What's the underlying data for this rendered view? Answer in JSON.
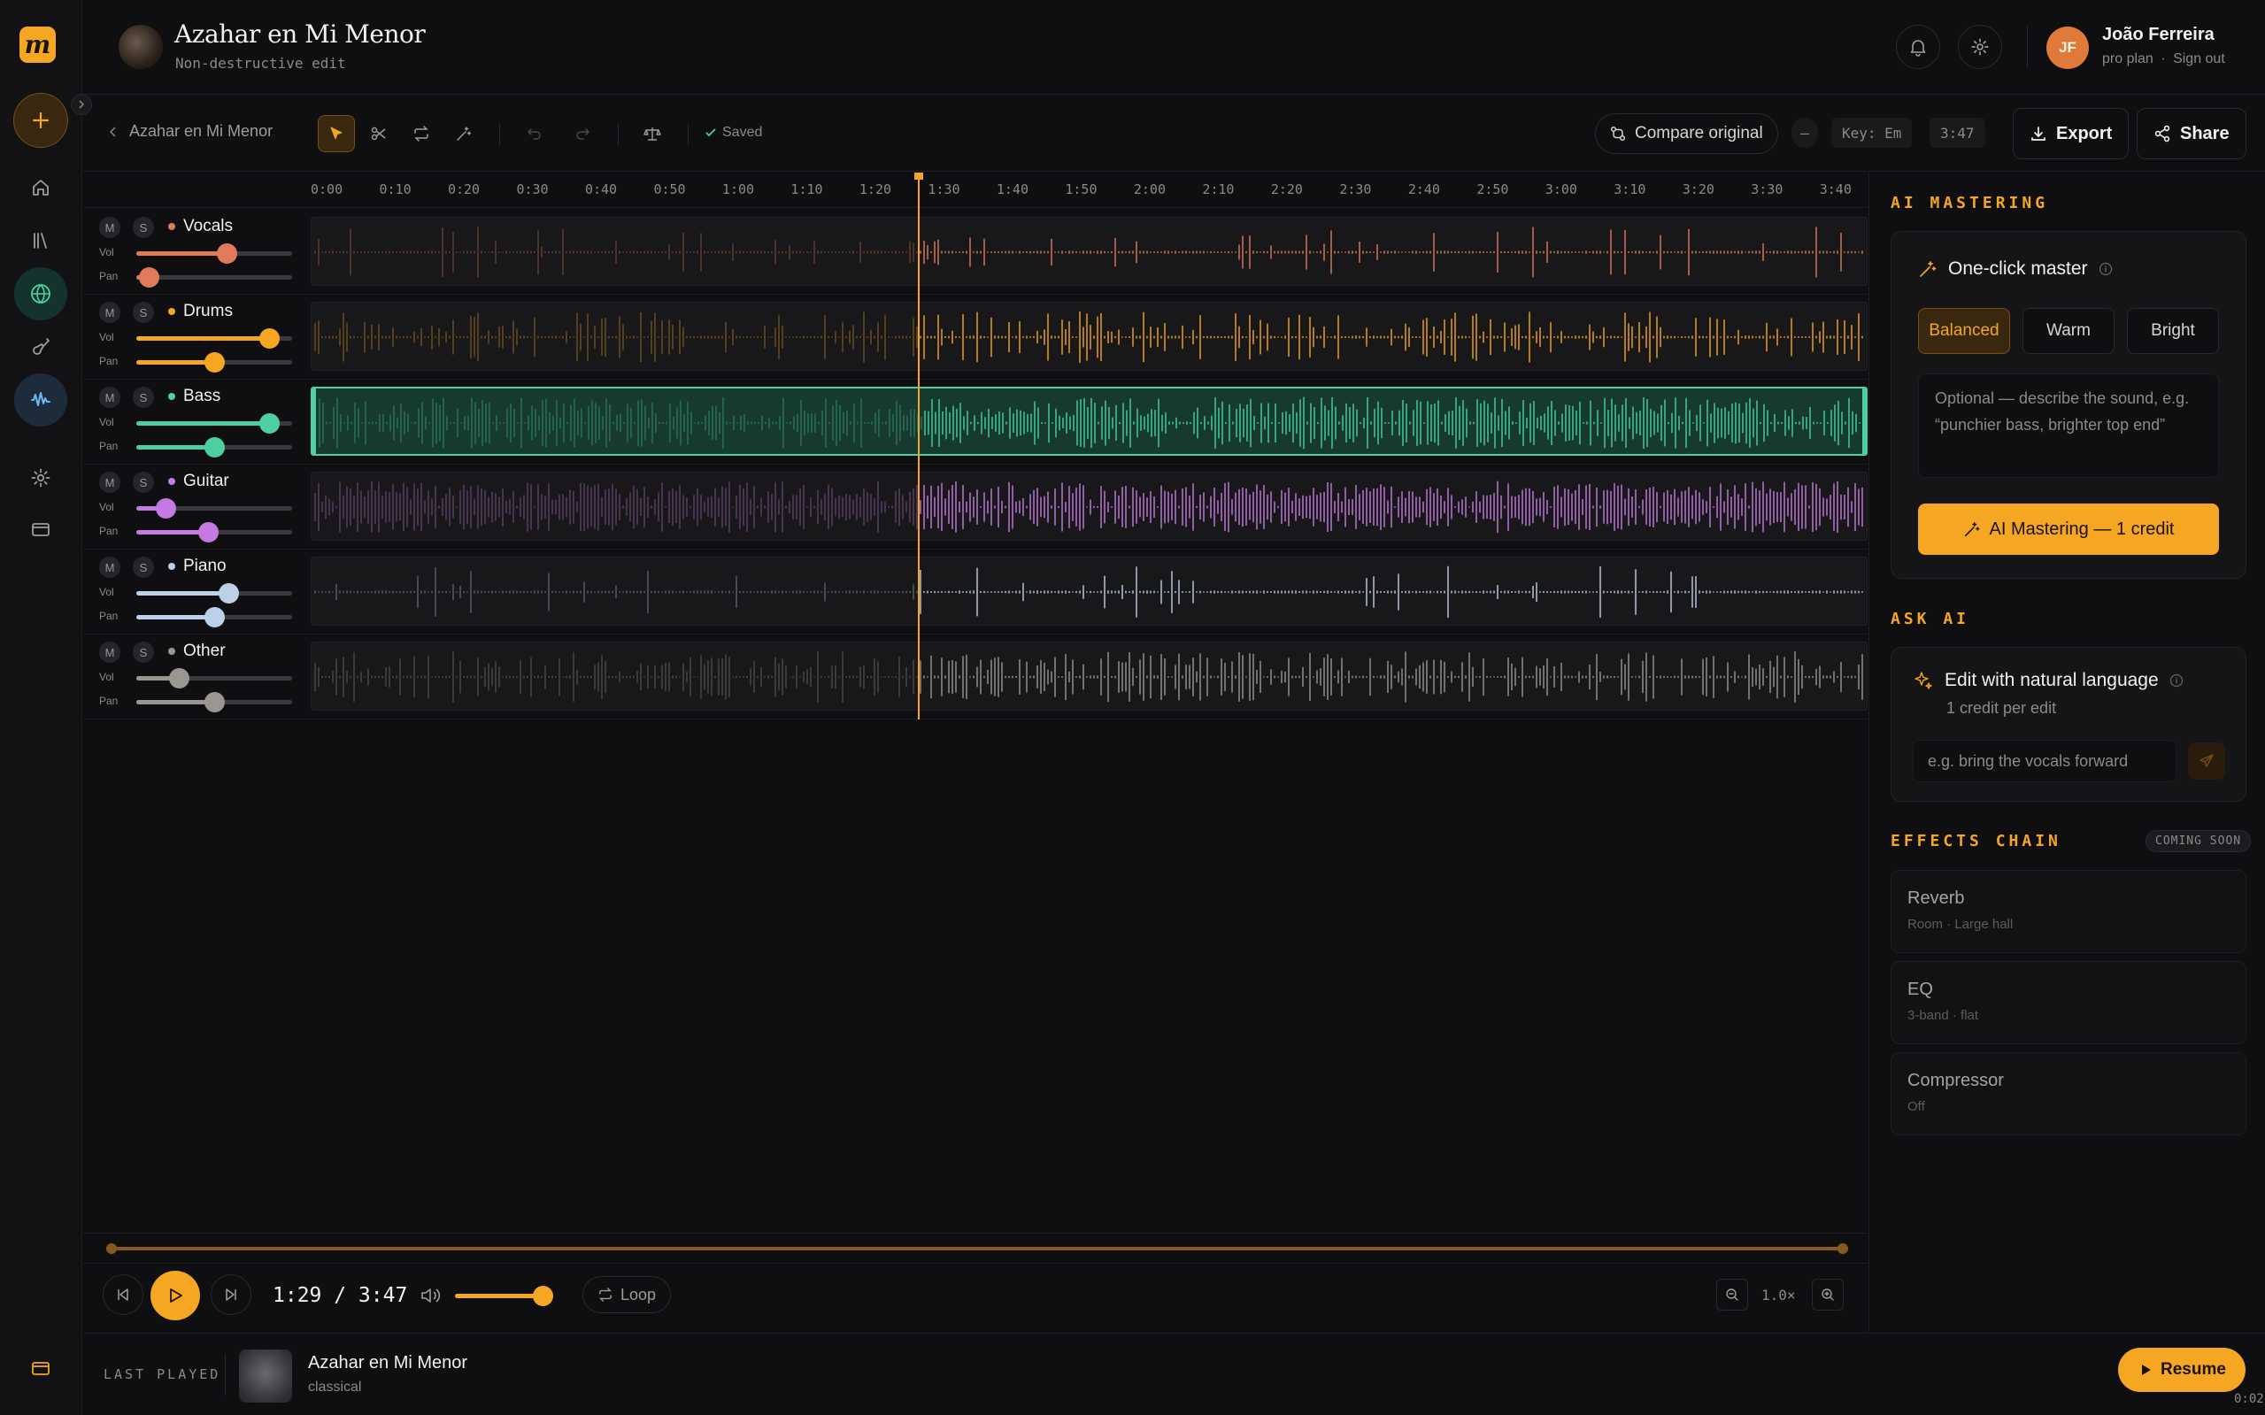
{
  "app": {
    "logo_letter": "m"
  },
  "header": {
    "title": "Azahar en Mi Menor",
    "subtitle": "Non-destructive edit",
    "user": {
      "initials": "JF",
      "name": "João Ferreira",
      "plan": "pro plan",
      "sign_out": "Sign out",
      "separator": "·"
    }
  },
  "toolbar": {
    "breadcrumb": "Azahar en Mi Menor",
    "saved_label": "Saved",
    "compare_label": "Compare original",
    "key_dash": "–",
    "key_label": "Key: Em",
    "duration": "3:47",
    "export_label": "Export",
    "share_label": "Share"
  },
  "ruler": [
    "0:00",
    "0:10",
    "0:20",
    "0:30",
    "0:40",
    "0:50",
    "1:00",
    "1:10",
    "1:20",
    "1:30",
    "1:40",
    "1:50",
    "2:00",
    "2:10",
    "2:20",
    "2:30",
    "2:40",
    "2:50",
    "3:00",
    "3:10",
    "3:20",
    "3:30",
    "3:40"
  ],
  "tracks": [
    {
      "name": "Vocals",
      "mute": "M",
      "solo": "S",
      "vol_label": "Vol",
      "pan_label": "Pan",
      "color": "#e07a5a",
      "vol": 0.58,
      "pan": 0.08
    },
    {
      "name": "Drums",
      "mute": "M",
      "solo": "S",
      "vol_label": "Vol",
      "pan_label": "Pan",
      "color": "#f5a623",
      "vol": 0.85,
      "pan": 0.5
    },
    {
      "name": "Bass",
      "mute": "M",
      "solo": "S",
      "vol_label": "Vol",
      "pan_label": "Pan",
      "color": "#4fcf9f",
      "vol": 0.85,
      "pan": 0.5
    },
    {
      "name": "Guitar",
      "mute": "M",
      "solo": "S",
      "vol_label": "Vol",
      "pan_label": "Pan",
      "color": "#c47ae0",
      "vol": 0.19,
      "pan": 0.46
    },
    {
      "name": "Piano",
      "mute": "M",
      "solo": "S",
      "vol_label": "Vol",
      "pan_label": "Pan",
      "color": "#bcd0e8",
      "vol": 0.59,
      "pan": 0.5
    },
    {
      "name": "Other",
      "mute": "M",
      "solo": "S",
      "vol_label": "Vol",
      "pan_label": "Pan",
      "color": "#9a9792",
      "vol": 0.27,
      "pan": 0.5
    }
  ],
  "playback": {
    "progress": 0.39
  },
  "transport": {
    "current_time": "1:29 / 3:47",
    "volume": 0.9,
    "loop_label": "Loop",
    "zoom_label": "1.0×"
  },
  "panel": {
    "mastering": {
      "section_title": "AI MASTERING",
      "heading": "One-click master",
      "options": [
        "Balanced",
        "Warm",
        "Bright"
      ],
      "selected": "Balanced",
      "prompt_placeholder": "Optional — describe the sound, e.g. “punchier bass, brighter top end”",
      "button_label": "AI Mastering — 1 credit"
    },
    "ask": {
      "section_title": "ASK AI",
      "heading": "Edit with natural language",
      "subheading": "1 credit per edit",
      "input_placeholder": "e.g. bring the vocals forward"
    },
    "effects": {
      "section_title": "EFFECTS CHAIN",
      "badge": "COMING SOON",
      "items": [
        {
          "name": "Reverb",
          "detail": "Room · Large hall"
        },
        {
          "name": "EQ",
          "detail": "3-band · flat"
        },
        {
          "name": "Compressor",
          "detail": "Off"
        }
      ]
    }
  },
  "last_played": {
    "label": "LAST PLAYED",
    "title": "Azahar en Mi Menor",
    "genre": "classical",
    "resume_label": "Resume",
    "time": "0:02"
  }
}
